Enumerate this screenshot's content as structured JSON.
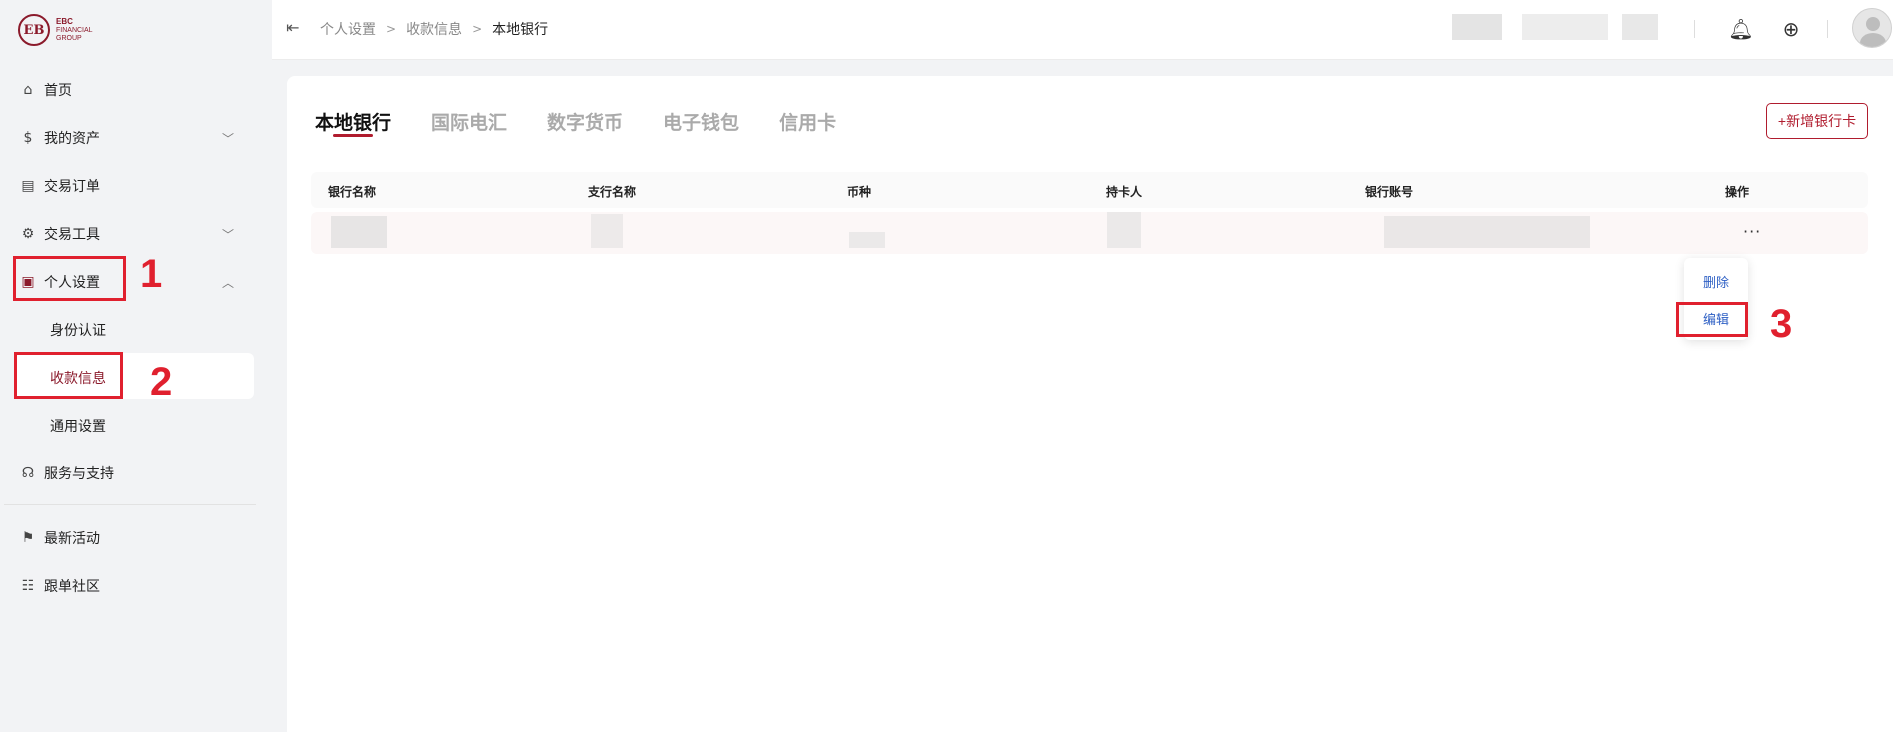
{
  "logo": {
    "mark": "EB",
    "line1": "EBC",
    "line2": "FINANCIAL",
    "line3": "GROUP"
  },
  "sidebar": {
    "items": [
      {
        "label": "首页",
        "icon": "home-icon"
      },
      {
        "label": "我的资产",
        "icon": "wallet-icon"
      },
      {
        "label": "交易订单",
        "icon": "orders-icon"
      },
      {
        "label": "交易工具",
        "icon": "tools-icon"
      },
      {
        "label": "个人设置",
        "icon": "user-settings-icon"
      },
      {
        "label": "服务与支持",
        "icon": "headset-icon"
      },
      {
        "label": "最新活动",
        "icon": "flag-icon"
      },
      {
        "label": "跟单社区",
        "icon": "community-icon"
      }
    ],
    "sub_items": [
      {
        "label": "身份认证"
      },
      {
        "label": "收款信息"
      },
      {
        "label": "通用设置"
      }
    ]
  },
  "header": {
    "breadcrumb": [
      "个人设置",
      "收款信息",
      "本地银行"
    ]
  },
  "tabs": [
    {
      "label": "本地银行"
    },
    {
      "label": "国际电汇"
    },
    {
      "label": "数字货币"
    },
    {
      "label": "电子钱包"
    },
    {
      "label": "信用卡"
    }
  ],
  "add_button": "+新增银行卡",
  "table": {
    "columns": [
      "银行名称",
      "支行名称",
      "币种",
      "持卡人",
      "银行账号",
      "操作"
    ],
    "more": "···"
  },
  "popover": {
    "delete": "删除",
    "edit": "编辑"
  },
  "steps": [
    "1",
    "2",
    "3"
  ],
  "colors": {
    "brand": "#8b1a2b",
    "accent": "#b01c2e",
    "annotation": "#e0202e",
    "link": "#2d5fc4"
  }
}
